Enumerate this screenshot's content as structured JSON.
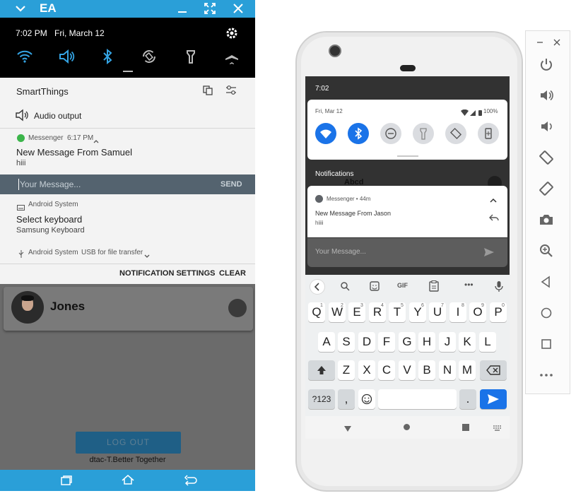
{
  "left_panel": {
    "titlebar": {
      "logo_text": "EA"
    },
    "status": {
      "time": "7:02 PM",
      "date": "Fri, March 12"
    },
    "notifications": {
      "smartthings": {
        "title": "SmartThings",
        "audio_output": "Audio output"
      },
      "messenger": {
        "app": "Messenger",
        "time": "6:17 PM",
        "title": "New Message From Samuel",
        "body": "hiii",
        "reply_placeholder": "Your Message...",
        "send_label": "SEND"
      },
      "android_keyboard": {
        "app": "Android System",
        "title": "Select keyboard",
        "body": "Samsung Keyboard"
      },
      "android_usb": {
        "app": "Android System",
        "text": "USB for file transfer"
      },
      "actions": {
        "settings_label": "NOTIFICATION SETTINGS",
        "clear_label": "CLEAR"
      }
    },
    "app": {
      "contact_name": "Jones",
      "logout_label": "LOG OUT",
      "footer": "dtac-T.Better Together"
    }
  },
  "phone": {
    "status_time": "7:02",
    "quick_settings": {
      "date": "Fri, Mar 12",
      "battery": "100%"
    },
    "notifications_header": "Notifications",
    "background_text": "Abcd",
    "messenger": {
      "app_line": "Messenger • 44m",
      "title": "New Message From Jason",
      "body": "hiiii",
      "reply_placeholder": "Your Message..."
    },
    "keyboard": {
      "gif_label": "GIF",
      "row1": [
        "Q",
        "W",
        "E",
        "R",
        "T",
        "Y",
        "U",
        "I",
        "O",
        "P"
      ],
      "row1_hints": [
        "1",
        "2",
        "3",
        "4",
        "5",
        "6",
        "7",
        "8",
        "9",
        "0"
      ],
      "row2": [
        "A",
        "S",
        "D",
        "F",
        "G",
        "H",
        "J",
        "K",
        "L"
      ],
      "row3": [
        "Z",
        "X",
        "C",
        "V",
        "B",
        "N",
        "M"
      ],
      "symbols_label": "?123",
      "comma": ",",
      "period": "."
    }
  },
  "colors": {
    "accent": "#2a9fd8",
    "phone_accent": "#1a73e8",
    "reply_bar": "#54636f"
  }
}
